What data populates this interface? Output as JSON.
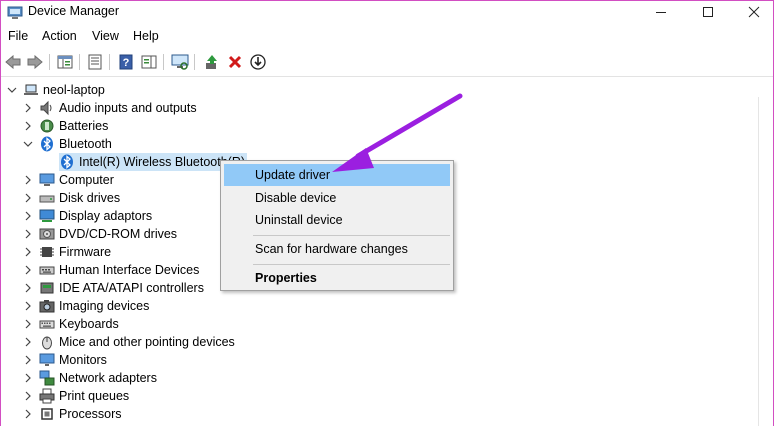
{
  "window": {
    "title": "Device Manager"
  },
  "menu": {
    "file": "File",
    "action": "Action",
    "view": "View",
    "help": "Help"
  },
  "toolbar": {
    "buttons": [
      "back-icon",
      "forward-icon",
      "show-hide-console-tree-icon",
      "properties-icon",
      "help-icon",
      "action-pane-icon",
      "scan-hardware-icon",
      "update-driver-icon",
      "uninstall-icon",
      "download-icon"
    ]
  },
  "tree": {
    "root": "neol-laptop",
    "items": [
      {
        "label": "Audio inputs and outputs",
        "icon": "speaker-icon"
      },
      {
        "label": "Batteries",
        "icon": "battery-icon"
      },
      {
        "label": "Bluetooth",
        "icon": "bluetooth-icon"
      },
      {
        "label": "Intel(R) Wireless Bluetooth(R)",
        "icon": "bluetooth-icon"
      },
      {
        "label": "Computer",
        "icon": "computer-icon"
      },
      {
        "label": "Disk drives",
        "icon": "disk-drive-icon"
      },
      {
        "label": "Display adaptors",
        "icon": "display-adapter-icon"
      },
      {
        "label": "DVD/CD-ROM drives",
        "icon": "dvd-drive-icon"
      },
      {
        "label": "Firmware",
        "icon": "firmware-icon"
      },
      {
        "label": "Human Interface Devices",
        "icon": "hid-icon"
      },
      {
        "label": "IDE ATA/ATAPI controllers",
        "icon": "ide-controller-icon"
      },
      {
        "label": "Imaging devices",
        "icon": "camera-icon"
      },
      {
        "label": "Keyboards",
        "icon": "keyboard-icon"
      },
      {
        "label": "Mice and other pointing devices",
        "icon": "mouse-icon"
      },
      {
        "label": "Monitors",
        "icon": "monitor-icon"
      },
      {
        "label": "Network adapters",
        "icon": "network-adapter-icon"
      },
      {
        "label": "Print queues",
        "icon": "printer-icon"
      },
      {
        "label": "Processors",
        "icon": "processor-icon"
      }
    ]
  },
  "context_menu": {
    "update_driver": "Update driver",
    "disable_device": "Disable device",
    "uninstall_device": "Uninstall device",
    "scan": "Scan for hardware changes",
    "properties": "Properties"
  },
  "colors": {
    "highlight": "#91c9f7",
    "arrow": "#9b1fe0",
    "border": "#d24ec2"
  }
}
